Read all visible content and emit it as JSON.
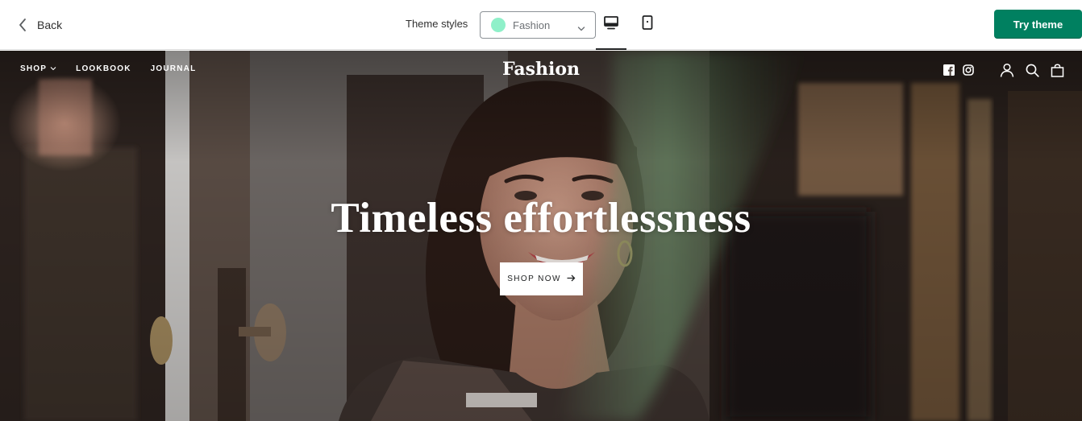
{
  "toolbar": {
    "back_label": "Back",
    "theme_styles_label": "Theme styles",
    "theme_select": {
      "value": "Fashion",
      "swatch_color": "#8ff0c9"
    },
    "devices": [
      "desktop",
      "mobile"
    ],
    "active_device": "desktop",
    "try_label": "Try theme",
    "try_color": "#008060"
  },
  "store": {
    "nav": [
      {
        "label": "SHOP",
        "has_dropdown": true
      },
      {
        "label": "LOOKBOOK",
        "has_dropdown": false
      },
      {
        "label": "JOURNAL",
        "has_dropdown": false
      }
    ],
    "brand": "Fashion",
    "icons": [
      "facebook-icon",
      "instagram-icon",
      "account-icon",
      "search-icon",
      "cart-icon"
    ]
  },
  "hero": {
    "title": "Timeless effortlessness",
    "cta_label": "SHOP NOW"
  }
}
